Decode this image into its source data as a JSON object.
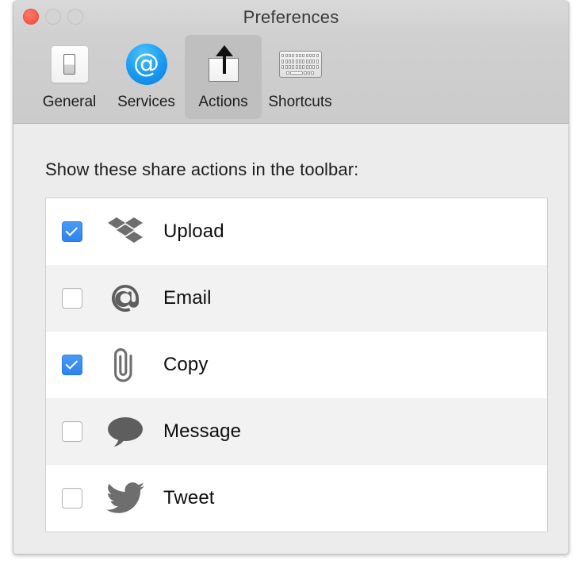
{
  "window": {
    "title": "Preferences",
    "traffic_lights": [
      {
        "name": "close",
        "color": "#fb5c4c"
      },
      {
        "name": "minimize",
        "color": "#d4d4d4"
      },
      {
        "name": "maximize",
        "color": "#d4d4d4"
      }
    ]
  },
  "toolbar": {
    "tabs": [
      {
        "label": "General",
        "icon": "light-switch-icon",
        "selected": false
      },
      {
        "label": "Services",
        "icon": "at-sign-icon",
        "selected": false
      },
      {
        "label": "Actions",
        "icon": "share-arrow-icon",
        "selected": true
      },
      {
        "label": "Shortcuts",
        "icon": "keyboard-icon",
        "selected": false
      }
    ]
  },
  "main": {
    "heading": "Show these share actions in the toolbar:",
    "rows": [
      {
        "label": "Upload",
        "icon": "dropbox-icon",
        "checked": true
      },
      {
        "label": "Email",
        "icon": "at-sign-icon",
        "checked": false
      },
      {
        "label": "Copy",
        "icon": "paperclip-icon",
        "checked": true
      },
      {
        "label": "Message",
        "icon": "speech-bubble-icon",
        "checked": false
      },
      {
        "label": "Tweet",
        "icon": "twitter-bird-icon",
        "checked": false
      }
    ]
  },
  "colors": {
    "accent_checkbox": "#3b8cf0",
    "titlebar": "#d0d0d0",
    "toolbar_selected": "#bfbfbf",
    "content_background": "#ececec",
    "row_alt": "#f2f2f2",
    "icon_gray": "#6e6e6e"
  }
}
